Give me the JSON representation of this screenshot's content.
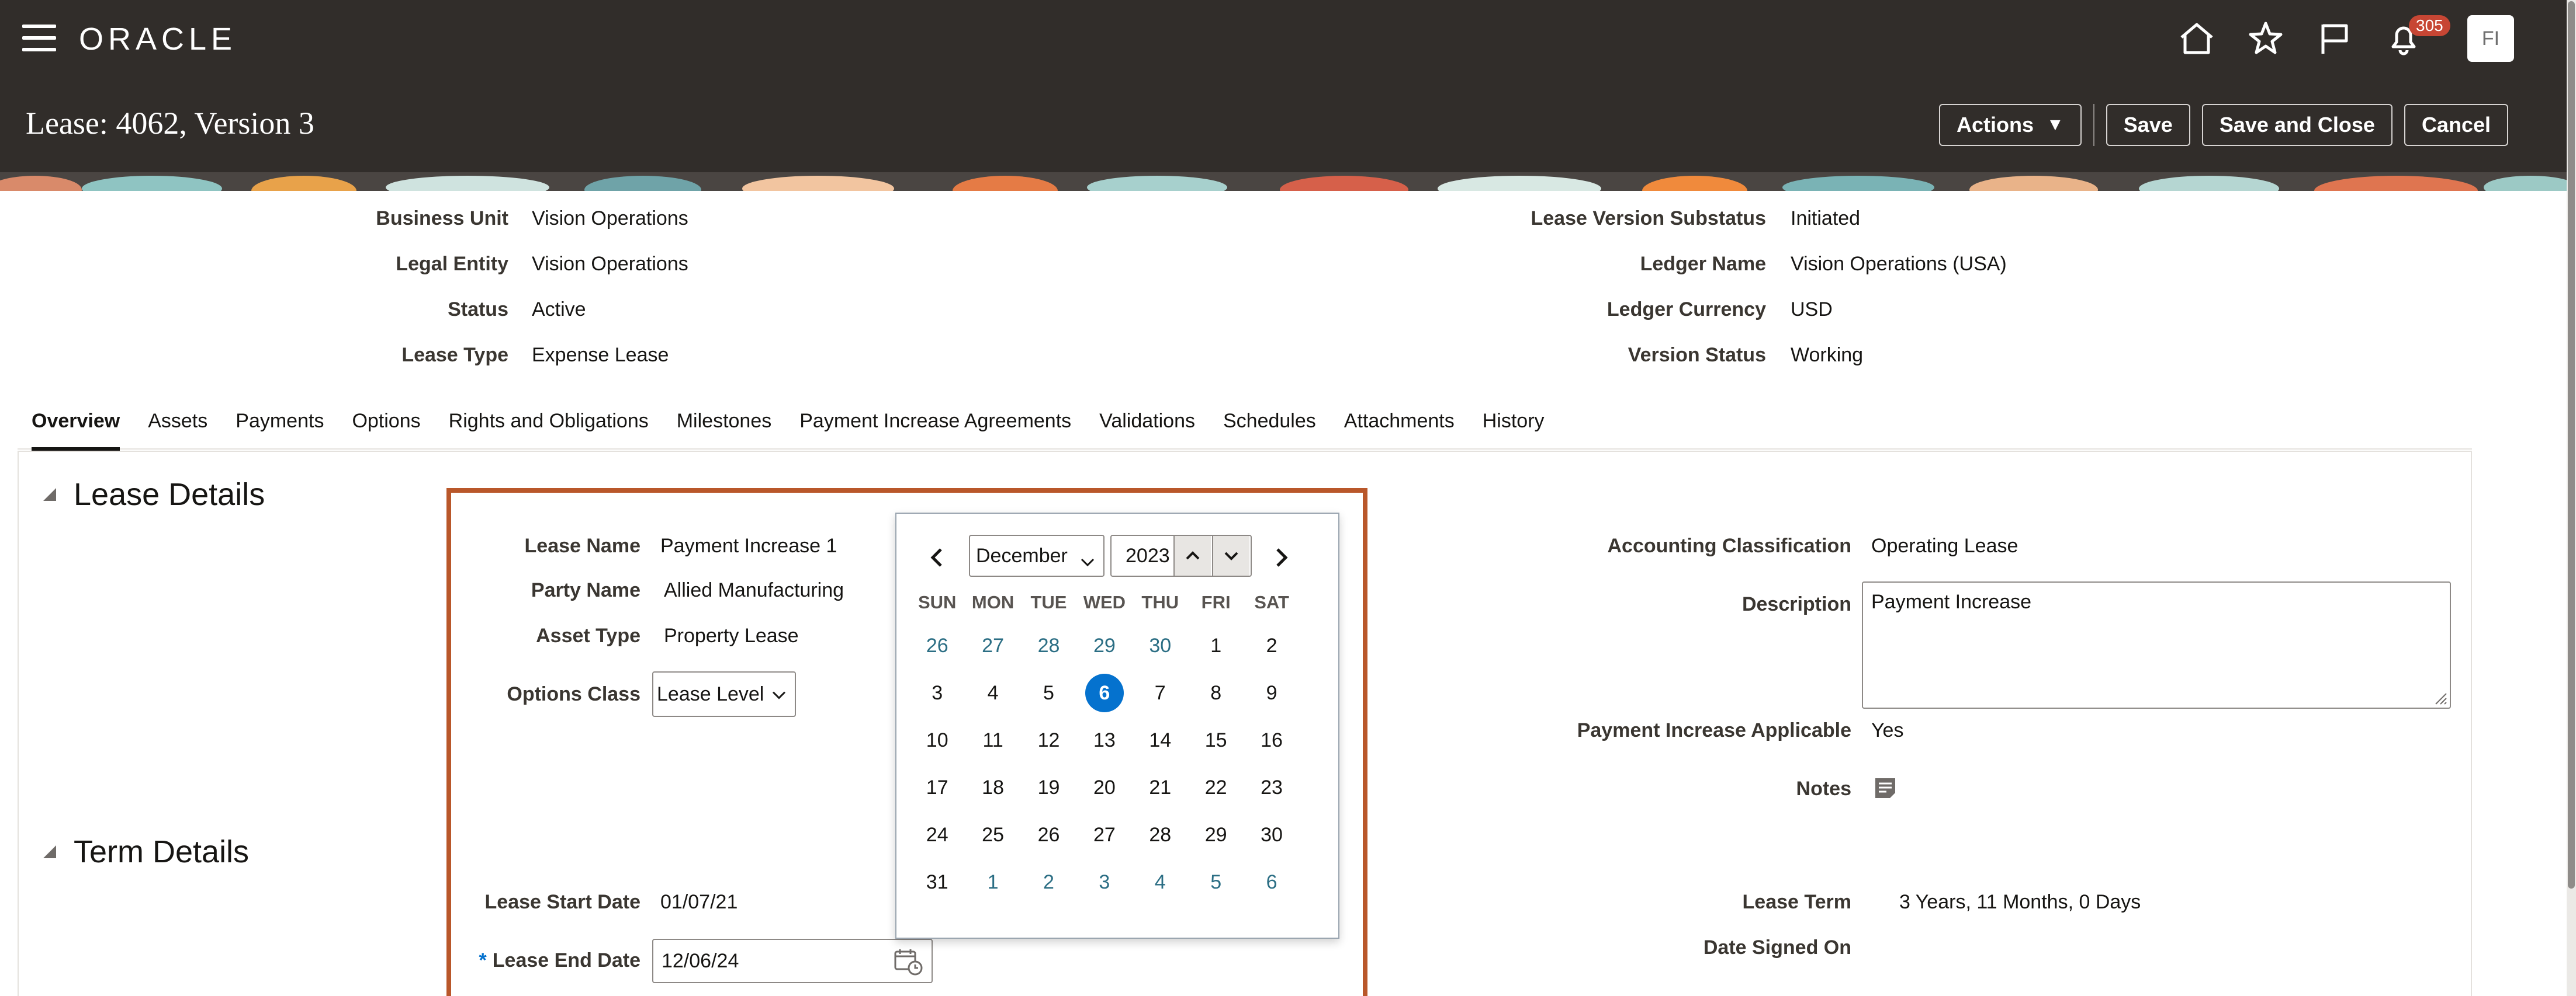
{
  "header": {
    "brand": "ORACLE",
    "notification_count": "305",
    "avatar_initials": "FI",
    "icons": [
      "home-icon",
      "favorites-star-icon",
      "flag-icon",
      "notifications-bell-icon"
    ]
  },
  "page": {
    "title": "Lease: 4062, Version 3",
    "actions_label": "Actions",
    "save_label": "Save",
    "save_close_label": "Save and Close",
    "cancel_label": "Cancel"
  },
  "info_left": [
    {
      "label": "Business Unit",
      "value": "Vision Operations"
    },
    {
      "label": "Legal Entity",
      "value": "Vision Operations"
    },
    {
      "label": "Status",
      "value": "Active"
    },
    {
      "label": "Lease Type",
      "value": "Expense Lease"
    }
  ],
  "info_right": [
    {
      "label": "Lease Version Substatus",
      "value": "Initiated"
    },
    {
      "label": "Ledger Name",
      "value": "Vision Operations (USA)"
    },
    {
      "label": "Ledger Currency",
      "value": "USD"
    },
    {
      "label": "Version Status",
      "value": "Working"
    }
  ],
  "tabs": [
    "Overview",
    "Assets",
    "Payments",
    "Options",
    "Rights and Obligations",
    "Milestones",
    "Payment Increase Agreements",
    "Validations",
    "Schedules",
    "Attachments",
    "History"
  ],
  "lease_details": {
    "title": "Lease Details",
    "lease_name_label": "Lease Name",
    "lease_name": "Payment Increase 1",
    "party_name_label": "Party Name",
    "party_name": "Allied Manufacturing",
    "asset_type_label": "Asset Type",
    "asset_type": "Property Lease",
    "options_class_label": "Options Class",
    "options_class": "Lease Level",
    "accounting_classification_label": "Accounting Classification",
    "accounting_classification": "Operating Lease",
    "description_label": "Description",
    "description": "Payment Increase",
    "payment_increase_applicable_label": "Payment Increase Applicable",
    "payment_increase_applicable": "Yes",
    "notes_label": "Notes"
  },
  "term_details": {
    "title": "Term Details",
    "lease_start_date_label": "Lease Start Date",
    "lease_start_date": "01/07/21",
    "lease_end_date_label": "Lease End Date",
    "lease_end_date": "12/06/24",
    "required_marker": "*",
    "lease_term_label": "Lease Term",
    "lease_term": "3 Years, 11 Months, 0 Days",
    "date_signed_on_label": "Date Signed On"
  },
  "calendar": {
    "month": "December",
    "year": "2023",
    "weekdays": [
      "SUN",
      "MON",
      "TUE",
      "WED",
      "THU",
      "FRI",
      "SAT"
    ],
    "weeks": [
      [
        "26",
        "27",
        "28",
        "29",
        "30",
        "1",
        "2"
      ],
      [
        "3",
        "4",
        "5",
        "6",
        "7",
        "8",
        "9"
      ],
      [
        "10",
        "11",
        "12",
        "13",
        "14",
        "15",
        "16"
      ],
      [
        "17",
        "18",
        "19",
        "20",
        "21",
        "22",
        "23"
      ],
      [
        "24",
        "25",
        "26",
        "27",
        "28",
        "29",
        "30"
      ],
      [
        "31",
        "1",
        "2",
        "3",
        "4",
        "5",
        "6"
      ]
    ],
    "selected_day": "6"
  },
  "colors": {
    "header_bg": "#312d2a",
    "highlight_border": "#b9572a",
    "selected_day": "#0572ce",
    "badge": "#c74634"
  }
}
